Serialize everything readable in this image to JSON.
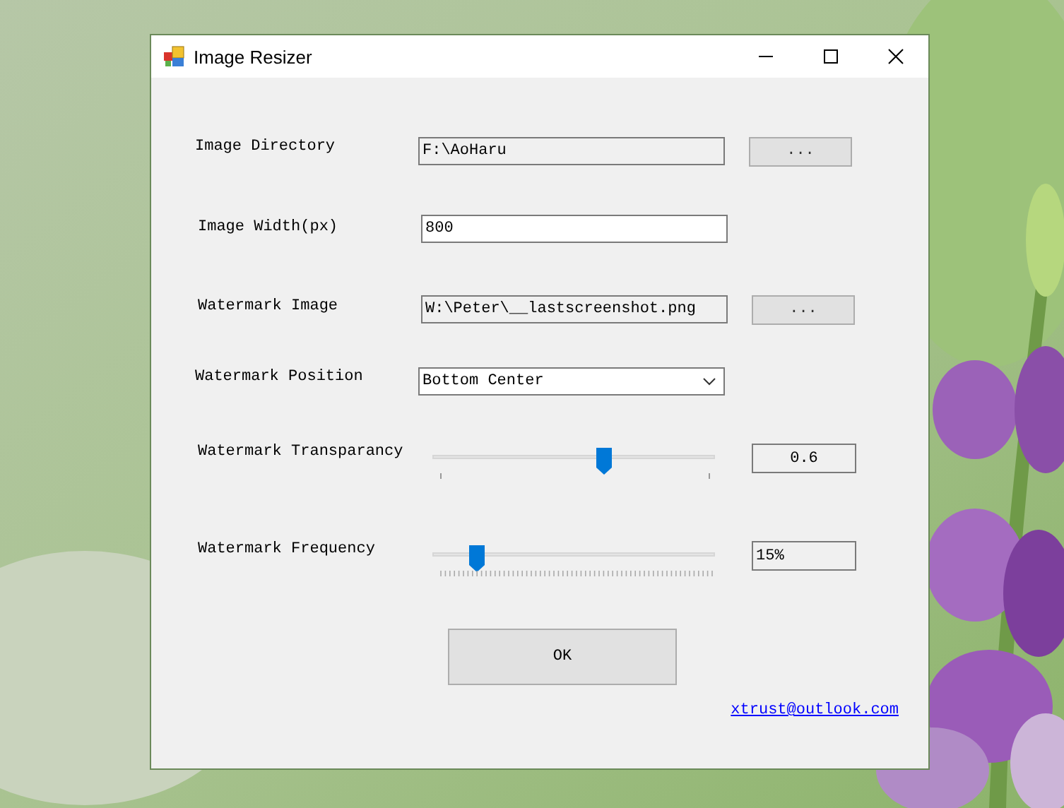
{
  "window": {
    "title": "Image Resizer"
  },
  "rows": [
    {
      "kind": "path",
      "label": "Image Directory",
      "value": "F:\\AoHaru",
      "button": "..."
    },
    {
      "kind": "text",
      "label": "Image Width(px)",
      "value": "800"
    },
    {
      "kind": "path",
      "label": "Watermark Image",
      "value": "W:\\Peter\\__lastscreenshot.png",
      "button": "..."
    },
    {
      "kind": "dropdown",
      "label": "Watermark Position",
      "value": "Bottom Center"
    },
    {
      "kind": "slider",
      "label": "Watermark Transparancy",
      "level": 0.6,
      "fine_ticks": false,
      "reading": "0.6",
      "centered": true
    },
    {
      "kind": "slider",
      "label": "Watermark Frequency",
      "level": 0.15,
      "fine_ticks": true,
      "reading": "15%",
      "centered": false
    }
  ],
  "ok_button": "OK",
  "link": "xtrust@outlook.com"
}
